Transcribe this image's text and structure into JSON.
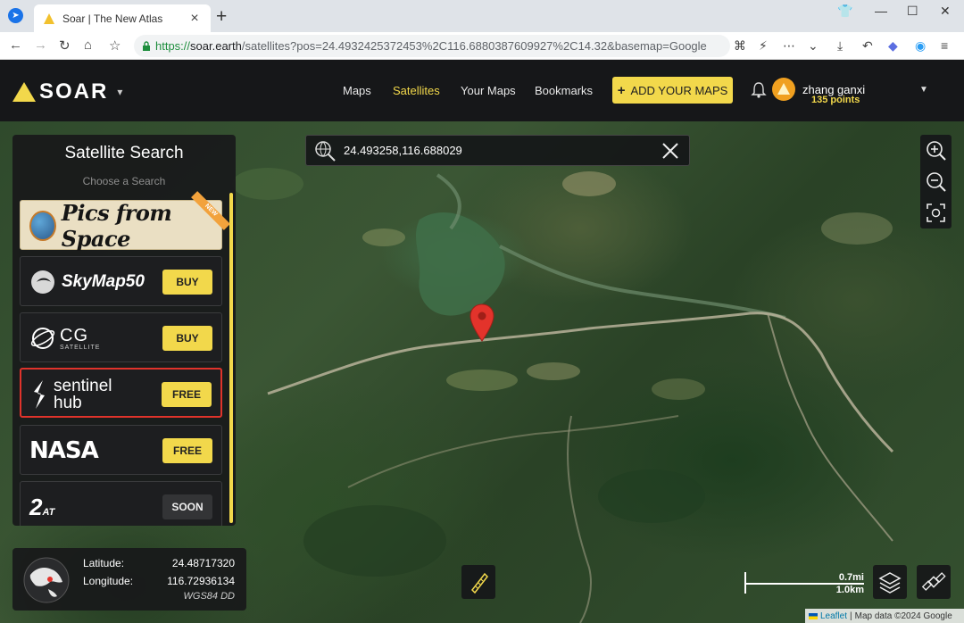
{
  "browser": {
    "tab_title": "Soar | The New Atlas",
    "url_proto": "https://",
    "url_host": "soar.earth",
    "url_rest": "/satellites?pos=24.4932425372453%2C116.6880387609927%2C14.32&basemap=Google"
  },
  "header": {
    "logo_text": "SOAR",
    "nav": {
      "maps": "Maps",
      "satellites": "Satellites",
      "your_maps": "Your Maps",
      "bookmarks": "Bookmarks"
    },
    "add_button": "ADD YOUR MAPS",
    "user_name": "zhang ganxi",
    "user_points": "135 points",
    "accent_color": "#f2d84b"
  },
  "panel": {
    "title": "Satellite Search",
    "subtitle": "Choose a Search",
    "providers": [
      {
        "name": "Pics from Space",
        "logo_text": "Pics from Space",
        "ribbon": "NEW",
        "button": ""
      },
      {
        "name": "SkyMap50",
        "logo_text": "SkyMap50",
        "button": "BUY"
      },
      {
        "name": "CG Satellite",
        "logo_text": "CG",
        "logo_sub": "SATELLITE",
        "button": "BUY"
      },
      {
        "name": "Sentinel Hub",
        "logo_text": "sentinel",
        "logo_sub": "hub",
        "button": "FREE"
      },
      {
        "name": "NASA",
        "logo_text": "NASA",
        "button": "FREE"
      },
      {
        "name": "21AT",
        "logo_text": "AT",
        "button": "SOON"
      }
    ]
  },
  "search": {
    "value": "24.493258,116.688029"
  },
  "coords": {
    "lat_label": "Latitude:",
    "lat_value": "24.48717320",
    "lon_label": "Longitude:",
    "lon_value": "116.72936134",
    "datum": "WGS84 DD"
  },
  "scale": {
    "miles": "0.7mi",
    "km": "1.0km"
  },
  "attribution": {
    "leaflet": "Leaflet",
    "sep": "|",
    "text": "Map data ©2024 Google"
  },
  "icons": {
    "app": "browser-app-icon",
    "favicon": "soar-triangle-icon",
    "zoom_in": "zoom-in-icon",
    "zoom_out": "zoom-out-icon",
    "fullscreen": "screen-capture-icon",
    "layers": "layers-icon",
    "satellite": "satellite-icon",
    "measure": "ruler-icon",
    "pin": "map-pin-icon",
    "bell": "bell-icon"
  }
}
